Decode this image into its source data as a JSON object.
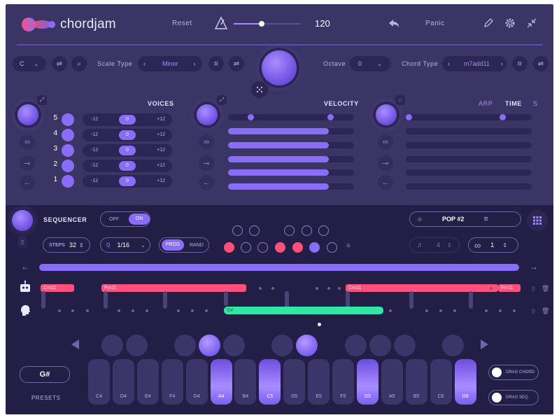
{
  "app": {
    "name": "chordjam"
  },
  "header": {
    "reset": "Reset",
    "tempo": "120",
    "tempo_fraction": 0.42,
    "panic": "Panic"
  },
  "controls": {
    "key_value": "C",
    "scale_type_label": "Scale Type",
    "scale_type_value": "Minor",
    "scale_r": "R",
    "octave_label": "Octave",
    "octave_value": "0",
    "chord_type_label": "Chord Type",
    "chord_type_value": "m7add11",
    "chord_r": "R"
  },
  "voices": {
    "title": "VOICES",
    "rows": [
      {
        "num": "5",
        "min": "-12",
        "val": "0",
        "max": "+12"
      },
      {
        "num": "4",
        "min": "-12",
        "val": "0",
        "max": "+12"
      },
      {
        "num": "3",
        "min": "-12",
        "val": "0",
        "max": "+12"
      },
      {
        "num": "2",
        "min": "-12",
        "val": "0",
        "max": "+12"
      },
      {
        "num": "1",
        "min": "-12",
        "val": "0",
        "max": "+12"
      }
    ]
  },
  "velocity": {
    "title": "VELOCITY",
    "bars": [
      0.8,
      0.8,
      0.8,
      0.8,
      0.8
    ]
  },
  "time": {
    "arp_label": "ARP",
    "time_label": "TIME",
    "s_label": "S"
  },
  "sequencer": {
    "title": "SEQUENCER",
    "off_label": "OFF",
    "on_label": "ON",
    "steps_label": "STEPS",
    "steps_value": "32",
    "q_label": "Q",
    "q_value": "1/16",
    "prog_label": "PROG",
    "rand_label": "RAND",
    "preset_name": "POP #2",
    "dim_value": "4",
    "loop_value": "1"
  },
  "chords": [
    {
      "name": "Cm11"
    },
    {
      "name": "Fm11"
    },
    {
      "name": "Cm11"
    },
    {
      "name": "Fm11"
    }
  ],
  "green_chord": {
    "name": "G#"
  },
  "keyboard": {
    "keys": [
      {
        "note": "C4",
        "on": false
      },
      {
        "note": "D4",
        "on": false
      },
      {
        "note": "E4",
        "on": false
      },
      {
        "note": "F4",
        "on": false
      },
      {
        "note": "G4",
        "on": false
      },
      {
        "note": "A4",
        "on": true
      },
      {
        "note": "B4",
        "on": false
      },
      {
        "note": "C5",
        "on": true
      },
      {
        "note": "D5",
        "on": false
      },
      {
        "note": "E5",
        "on": false
      },
      {
        "note": "F5",
        "on": false
      },
      {
        "note": "G5",
        "on": true
      },
      {
        "note": "A5",
        "on": false
      },
      {
        "note": "B5",
        "on": false
      },
      {
        "note": "C6",
        "on": false
      },
      {
        "note": "D6",
        "on": true
      }
    ]
  },
  "current_chord": "G#",
  "presets_label": "PRESETS",
  "drag_chord_label": "DRAG CHORD",
  "drag_seq_label": "DRAG SEQ",
  "colors": {
    "accent": "#8a6df7",
    "red": "#ff4f7b",
    "green": "#33e6a6",
    "panel": "#3b3566",
    "dark": "#231e45"
  }
}
